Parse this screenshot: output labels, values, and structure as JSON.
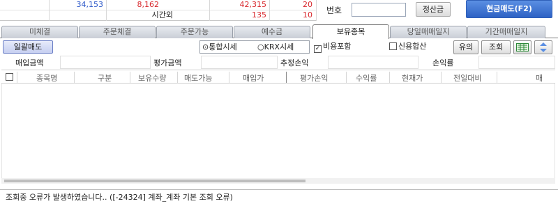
{
  "top_rows": {
    "row1": {
      "c1": "34,153",
      "c2": "8,162",
      "c3": "42,315",
      "c4": "20"
    },
    "row2": {
      "label": "시간외",
      "c3": "135",
      "c4": "10"
    }
  },
  "right_panel": {
    "number_label": "번호",
    "number_value": "",
    "settle_button": "정산금",
    "cash_sell_button": "현금매도(F2)"
  },
  "tabs": [
    "미체결",
    "주문체결",
    "주문가능",
    "예수금",
    "보유종목",
    "당일매매일지",
    "기간매매일지"
  ],
  "active_tab": 4,
  "toolbar": {
    "bulk_sell": "일괄매도",
    "radio_integrated": "통합시세",
    "radio_krx": "KRX시세",
    "include_cost": "비용포함",
    "credit_combined": "신용합산",
    "notice_button": "유의",
    "query_button": "조회",
    "icon_excel": "excel-icon",
    "icon_scroll": "scroll-updown-icon"
  },
  "summary": {
    "purchase_amount": "매입금액",
    "valuation_amount": "평가금액",
    "estimated_pnl": "추정손익",
    "pnl_rate": "손익률"
  },
  "grid_headers": [
    "종목명",
    "구분",
    "보유수량",
    "매도가능",
    "매입가",
    "평가손익",
    "수익률",
    "현재가",
    "전일대비",
    "매"
  ],
  "status_message": "조회중 오류가 발생하였습니다.. ([-24324] 계좌_계좌 기본 조회 오류)",
  "colors": {
    "accent_blue": "#2d62c4",
    "up_red": "#d8262b",
    "down_blue": "#2a56c8"
  }
}
